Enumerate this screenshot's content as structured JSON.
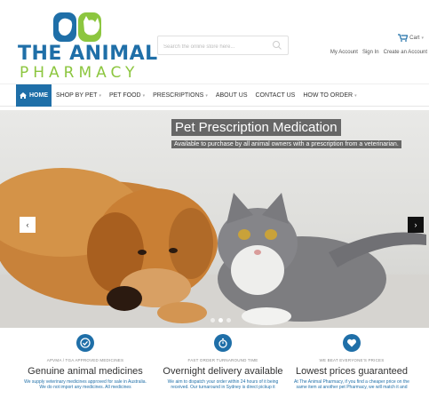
{
  "header": {
    "logo": {
      "line1": "THE ANIMAL",
      "line2": "PHARMACY"
    },
    "search": {
      "placeholder": "Search the online store here..."
    },
    "cart_label": "Cart",
    "account_links": [
      "My Account",
      "Sign In",
      "Create an Account"
    ]
  },
  "nav": {
    "home_label": "HOME",
    "items": [
      {
        "label": "SHOP BY PET",
        "has_dropdown": true
      },
      {
        "label": "PET FOOD",
        "has_dropdown": true
      },
      {
        "label": "PRESCRIPTIONS",
        "has_dropdown": true
      },
      {
        "label": "ABOUT US",
        "has_dropdown": false
      },
      {
        "label": "CONTACT US",
        "has_dropdown": false
      },
      {
        "label": "HOW TO ORDER",
        "has_dropdown": true
      }
    ]
  },
  "hero": {
    "title": "Pet Prescription Medication",
    "subtitle": "Available to purchase by all animal owners with a prescription from a veterinarian.",
    "slide_count": 3,
    "active_slide": 2
  },
  "features": [
    {
      "icon": "check-badge-icon",
      "kicker": "APVMA / TGA APPROVED MEDICINES",
      "heading": "Genuine animal medicines",
      "body": "We supply veterinary medicines approved for sale in Australia. We do not import any medicines. All medicines"
    },
    {
      "icon": "stopwatch-icon",
      "kicker": "FAST ORDER TURNAROUND TIME",
      "heading": "Overnight delivery available",
      "body": "We aim to dispatch your order within 24 hours of it being received. Our turnaround in Sydney is direct pickup it"
    },
    {
      "icon": "heart-icon",
      "kicker": "WE BEAT EVERYONE'S PRICES",
      "heading": "Lowest prices guaranteed",
      "body": "At The Animal Pharmacy, if you find a cheaper price on the same item at another pet Pharmacy, we will match it and"
    }
  ],
  "colors": {
    "brand_blue": "#1f6fa8",
    "brand_green": "#8cc63f"
  }
}
